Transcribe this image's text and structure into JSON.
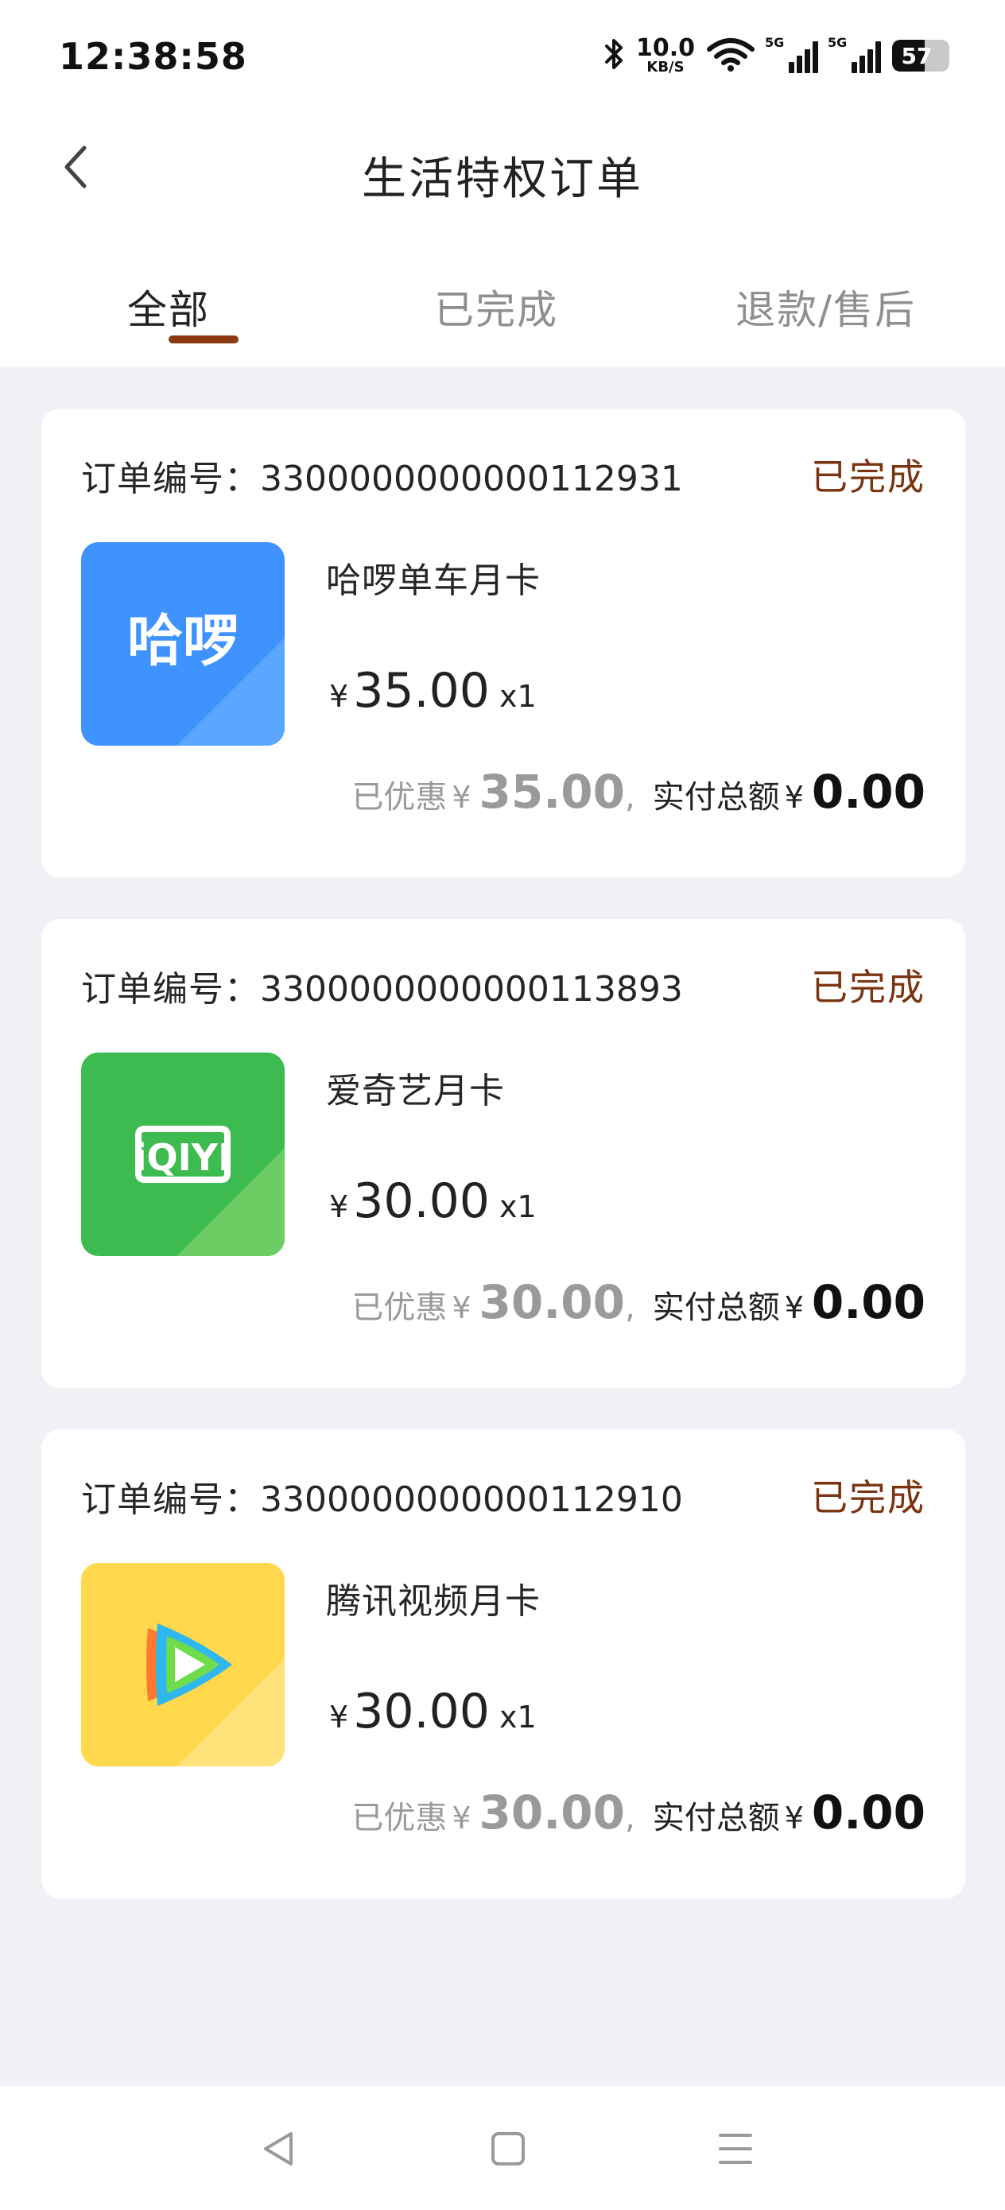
{
  "status_bar": {
    "time": "12:38:58",
    "net_speed_value": "10.0",
    "net_speed_unit": "KB/S",
    "signal1_label": "5G",
    "signal2_label": "5G",
    "battery_level": "57",
    "icons": [
      "bluetooth-icon",
      "wifi-icon",
      "signal-5g-icon",
      "signal-5g-icon",
      "battery-icon"
    ]
  },
  "header": {
    "title": "生活特权订单",
    "back_icon": "chevron-left-icon"
  },
  "tabs": [
    {
      "label": "全部",
      "active": true
    },
    {
      "label": "已完成",
      "active": false
    },
    {
      "label": "退款/售后",
      "active": false
    }
  ],
  "orders": [
    {
      "order_no_label": "订单编号：",
      "order_no": "3300000000000112931",
      "status": "已完成",
      "product_name": "哈啰单车月卡",
      "currency": "¥",
      "price": "35.00",
      "quantity": "x1",
      "discount_label": "已优惠",
      "discount_amount": "35.00",
      "separator": ",",
      "paid_label": "实付总额",
      "paid_amount": "0.00",
      "thumb_text": "哈啰",
      "thumb_colors": [
        "#3f93ff",
        "#2a7de8"
      ],
      "thumb_icon": "hellobike-logo-icon"
    },
    {
      "order_no_label": "订单编号：",
      "order_no": "3300000000000113893",
      "status": "已完成",
      "product_name": "爱奇艺月卡",
      "currency": "¥",
      "price": "30.00",
      "quantity": "x1",
      "discount_label": "已优惠",
      "discount_amount": "30.00",
      "separator": ",",
      "paid_label": "实付总额",
      "paid_amount": "0.00",
      "thumb_text": "iQIYI",
      "thumb_colors": [
        "#3dbb50",
        "#6ccd65"
      ],
      "thumb_icon": "iqiyi-logo-icon"
    },
    {
      "order_no_label": "订单编号：",
      "order_no": "3300000000000112910",
      "status": "已完成",
      "product_name": "腾讯视频月卡",
      "currency": "¥",
      "price": "30.00",
      "quantity": "x1",
      "discount_label": "已优惠",
      "discount_amount": "30.00",
      "separator": ",",
      "paid_label": "实付总额",
      "paid_amount": "0.00",
      "thumb_text": "",
      "thumb_colors": [
        "#ffd84d",
        "#ffe27a"
      ],
      "thumb_icon": "tencent-video-logo-icon"
    }
  ],
  "system_nav": {
    "buttons": [
      "back-triangle-icon",
      "home-square-icon",
      "menu-lines-icon"
    ]
  },
  "colors": {
    "accent": "#8b3a12",
    "status_text": "#7b3410",
    "background": "#eff1f5"
  }
}
